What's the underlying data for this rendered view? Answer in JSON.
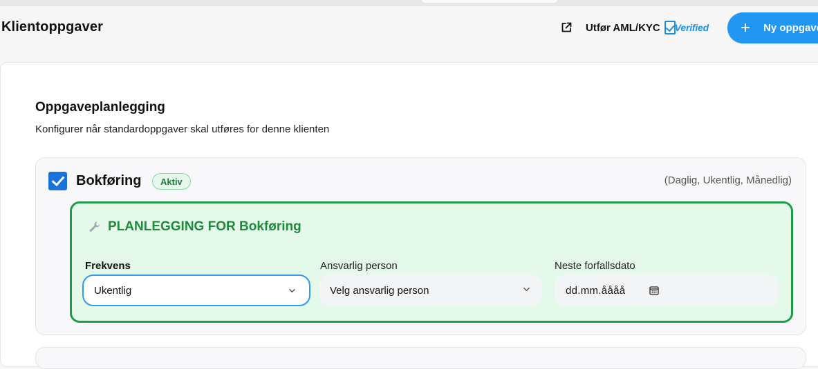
{
  "header": {
    "title": "Klientoppgaver",
    "aml_link": "Utfør AML/KYC",
    "verified_badge": "Verified",
    "new_button": "Ny oppgave",
    "new_button_icon": "plus-icon",
    "ext_icon": "external-link-icon"
  },
  "section": {
    "title": "Oppgaveplanlegging",
    "subtitle": "Konfigurer når standardoppgaver skal utføres for denne klienten"
  },
  "task": {
    "name": "Bokføring",
    "checked": true,
    "status_badge": "Aktiv",
    "frequency_hint": "(Daglig, Ukentlig, Månedlig)",
    "planning_title": "PLANLEGGING FOR Bokføring",
    "planning_icon": "wrench-icon",
    "fields": {
      "frequency_label": "Frekvens",
      "frequency_value": "Ukentlig",
      "responsible_label": "Ansvarlig person",
      "responsible_value": "Velg ansvarlig person",
      "due_label": "Neste forfallsdato",
      "due_value": "dd.mm.åååå"
    }
  },
  "colors": {
    "accent": "#2196f3",
    "checkbox": "#1a73d9",
    "plan_border": "#1f9c47",
    "plan_bg": "#e4f9e9",
    "badge_text": "#1f7a3e"
  }
}
